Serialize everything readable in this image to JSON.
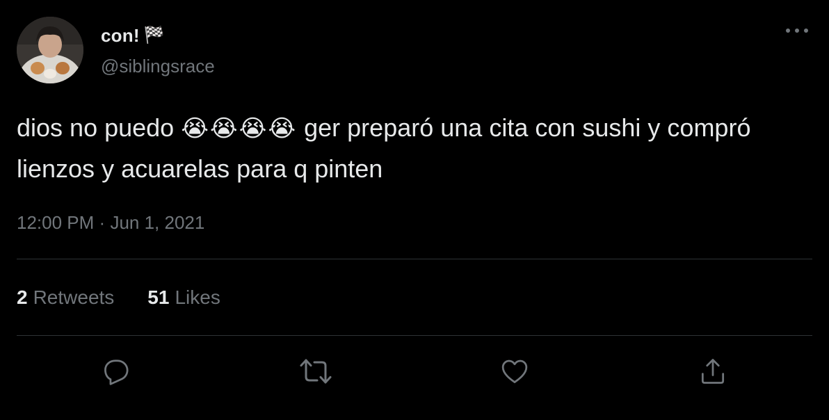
{
  "tweet": {
    "author": {
      "display_name": "con!",
      "name_emoji": "🏁",
      "handle": "@siblingsrace"
    },
    "text_before": "dios no puedo ",
    "emojis": "😭😭😭😭",
    "text_after": " ger preparó una cita con sushi y compró lienzos y acuarelas para q pinten",
    "time": "12:00 PM",
    "separator": "·",
    "date": "Jun 1, 2021",
    "stats": {
      "retweets_count": "2",
      "retweets_label": "Retweets",
      "likes_count": "51",
      "likes_label": "Likes"
    },
    "actions": [
      "reply-icon",
      "retweet-icon",
      "like-icon",
      "share-icon"
    ],
    "more_icon": "more-horizontal-icon"
  },
  "colors": {
    "background": "#000000",
    "primary_text": "#e7e9ea",
    "secondary_text": "#71767b",
    "divider": "#2f3336"
  }
}
